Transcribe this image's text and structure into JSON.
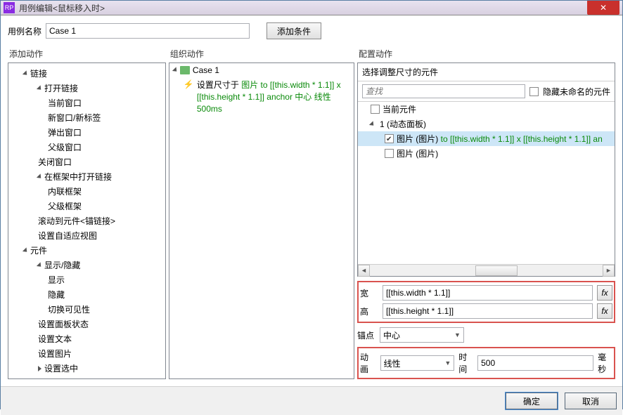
{
  "titlebar": {
    "icon": "RP",
    "title": "用例编辑<鼠标移入时>"
  },
  "row1": {
    "name_label": "用例名称",
    "name_value": "Case 1",
    "add_condition": "添加条件"
  },
  "headers": {
    "left": "添加动作",
    "mid": "组织动作",
    "right": "配置动作"
  },
  "tree": [
    {
      "lvl": 0,
      "exp": true,
      "label": "链接"
    },
    {
      "lvl": 1,
      "exp": true,
      "label": "打开链接"
    },
    {
      "lvl": 2,
      "label": "当前窗口"
    },
    {
      "lvl": 2,
      "label": "新窗口/新标签"
    },
    {
      "lvl": 2,
      "label": "弹出窗口"
    },
    {
      "lvl": 2,
      "label": "父级窗口"
    },
    {
      "lvl": 1,
      "label": "关闭窗口"
    },
    {
      "lvl": 1,
      "exp": true,
      "label": "在框架中打开链接"
    },
    {
      "lvl": 2,
      "label": "内联框架"
    },
    {
      "lvl": 2,
      "label": "父级框架"
    },
    {
      "lvl": 1,
      "label": "滚动到元件<锚链接>"
    },
    {
      "lvl": 1,
      "label": "设置自适应视图"
    },
    {
      "lvl": 0,
      "exp": true,
      "label": "元件"
    },
    {
      "lvl": 1,
      "exp": true,
      "label": "显示/隐藏"
    },
    {
      "lvl": 2,
      "label": "显示"
    },
    {
      "lvl": 2,
      "label": "隐藏"
    },
    {
      "lvl": 2,
      "label": "切换可见性"
    },
    {
      "lvl": 1,
      "label": "设置面板状态"
    },
    {
      "lvl": 1,
      "label": "设置文本"
    },
    {
      "lvl": 1,
      "label": "设置图片"
    },
    {
      "lvl": 1,
      "exp": false,
      "label": "设置选中"
    }
  ],
  "mid": {
    "case_label": "Case 1",
    "action_prefix": "设置尺寸于 ",
    "action_green": "图片 to [[this.width * 1.1]]  x [[this.height * 1.1]] anchor 中心 线性 500ms"
  },
  "right": {
    "subheader": "选择调整尺寸的元件",
    "search_placeholder": "查找",
    "hide_unnamed": "隐藏未命名的元件",
    "items": [
      {
        "indent": 0,
        "chk": false,
        "label": "当前元件"
      },
      {
        "indent": 0,
        "exp": true,
        "label": "1 (动态面板)"
      },
      {
        "indent": 1,
        "chk": true,
        "sel": true,
        "prefix": "图片 (图片) ",
        "green": "to [[this.width * 1.1]]  x [[this.height * 1.1]] an"
      },
      {
        "indent": 1,
        "chk": false,
        "label": "图片 (图片)"
      }
    ],
    "cfg": {
      "w_label": "宽",
      "w_value": "[[this.width * 1.1]]",
      "h_label": "高",
      "h_value": "[[this.height * 1.1]]",
      "anchor_label": "锚点",
      "anchor_value": "中心",
      "anim_label": "动画",
      "anim_value": "线性",
      "time_label": "时间",
      "time_value": "500",
      "time_unit": "毫秒",
      "fx": "fx"
    }
  },
  "footer": {
    "ok": "确定",
    "cancel": "取消"
  }
}
